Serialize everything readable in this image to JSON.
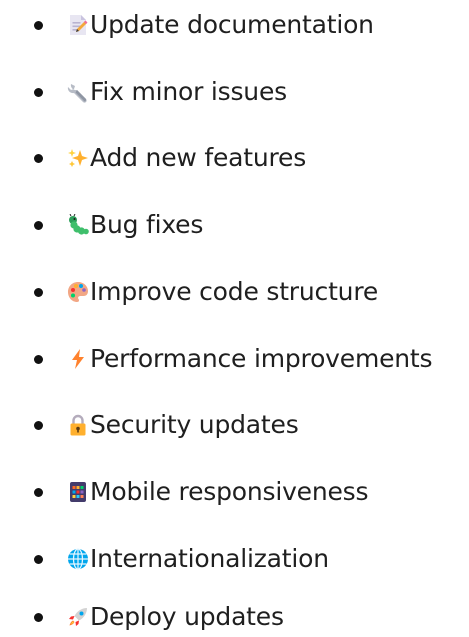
{
  "list": {
    "items": [
      {
        "label": "Update documentation",
        "icon": "memo-pencil-icon"
      },
      {
        "label": "Fix minor issues",
        "icon": "wrench-icon"
      },
      {
        "label": "Add new features",
        "icon": "sparkles-icon"
      },
      {
        "label": "Bug fixes",
        "icon": "caterpillar-bug-icon"
      },
      {
        "label": "Improve code structure",
        "icon": "artist-palette-icon"
      },
      {
        "label": "Performance improvements",
        "icon": "lightning-bolt-icon"
      },
      {
        "label": "Security updates",
        "icon": "padlock-icon"
      },
      {
        "label": "Mobile responsiveness",
        "icon": "mobile-app-grid-icon"
      },
      {
        "label": "Internationalization",
        "icon": "globe-icon"
      },
      {
        "label": "Deploy updates",
        "icon": "rocket-icon"
      }
    ]
  },
  "colors": {
    "text": "#1f1f1f",
    "bullet": "#111111",
    "background": "#ffffff"
  }
}
